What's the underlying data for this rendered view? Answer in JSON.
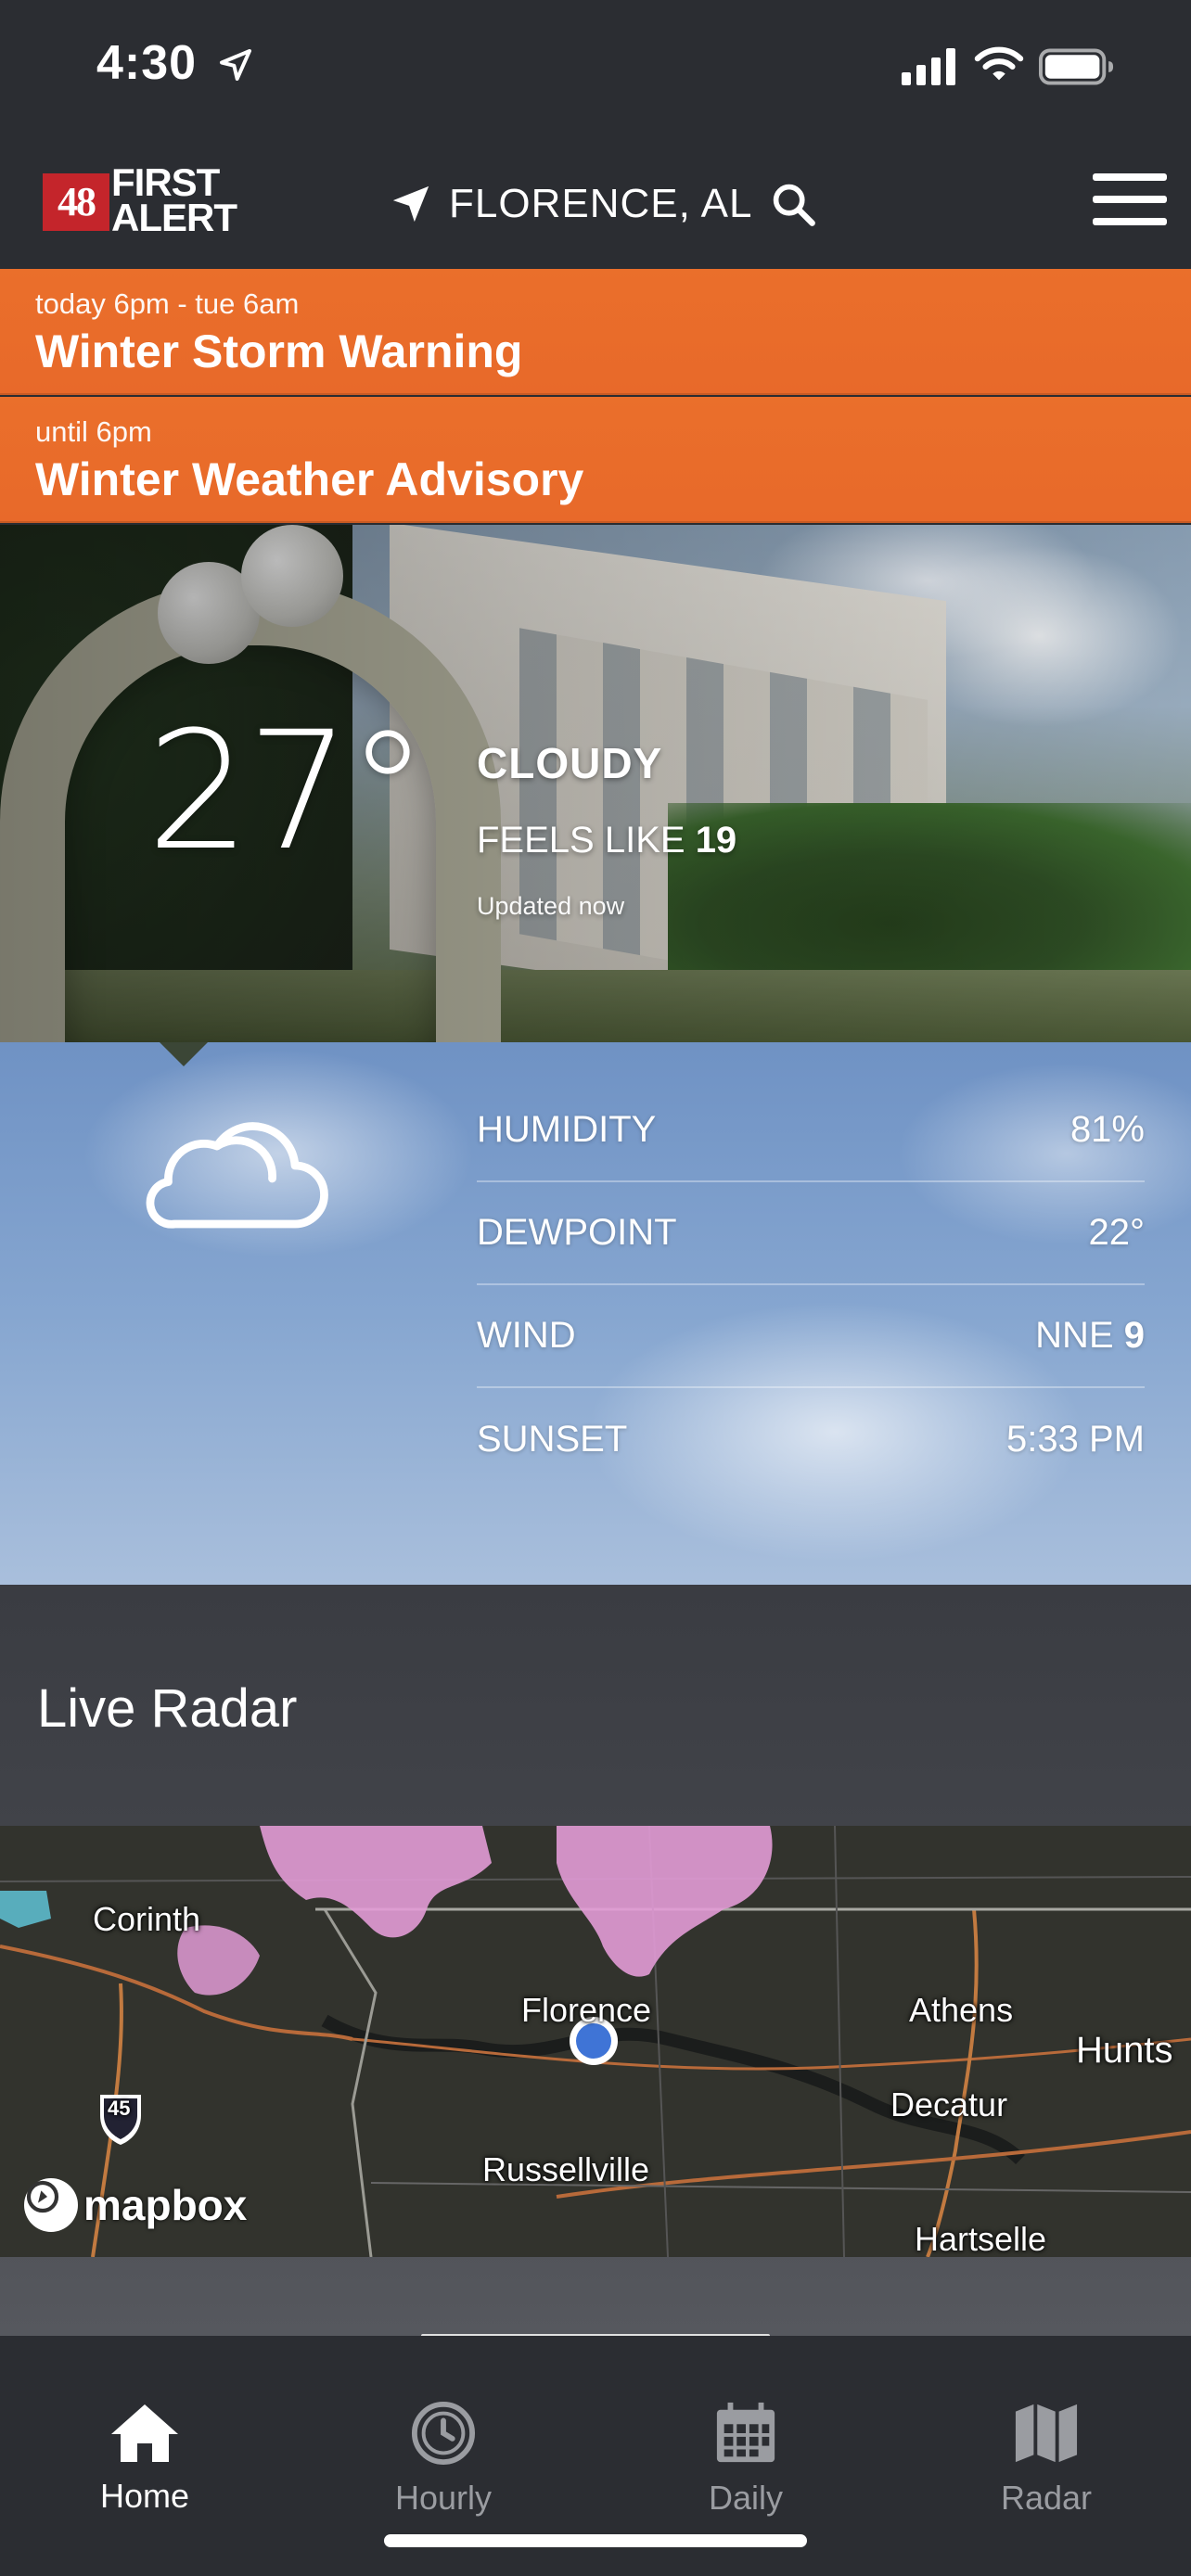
{
  "status_bar": {
    "time": "4:30"
  },
  "header": {
    "logo_number": "48",
    "logo_line1": "FIRST",
    "logo_line2": "ALERT",
    "location": "FLORENCE, AL"
  },
  "alerts": [
    {
      "time": "today 6pm - tue 6am",
      "title": "Winter Storm Warning"
    },
    {
      "time": "until 6pm",
      "title": "Winter Weather Advisory"
    }
  ],
  "current": {
    "temperature": "27°",
    "condition": "CLOUDY",
    "feels_like_label": "FEELS LIKE",
    "feels_like_value": "19",
    "updated": "Updated now"
  },
  "details": [
    {
      "label": "HUMIDITY",
      "value": "81%"
    },
    {
      "label": "DEWPOINT",
      "value": "22°"
    },
    {
      "label": "WIND",
      "value_prefix": "NNE",
      "value": "9"
    },
    {
      "label": "SUNSET",
      "value": "5:33 PM"
    }
  ],
  "radar": {
    "title": "Live Radar",
    "map_labels": [
      "Corinth",
      "Florence",
      "Athens",
      "Hunts",
      "Decatur",
      "Russellville",
      "Hartselle"
    ],
    "route_shield": "45",
    "attribution": "mapbox"
  },
  "tabs": [
    {
      "label": "Home",
      "icon": "home-icon",
      "active": true
    },
    {
      "label": "Hourly",
      "icon": "clock-icon",
      "active": false
    },
    {
      "label": "Daily",
      "icon": "calendar-icon",
      "active": false
    },
    {
      "label": "Radar",
      "icon": "map-icon",
      "active": false
    }
  ],
  "colors": {
    "alert_orange": "#e96d2b",
    "header_bg": "#2b2d32",
    "radar_precip": "#e59ad6",
    "location_dot": "#3f74d6"
  }
}
